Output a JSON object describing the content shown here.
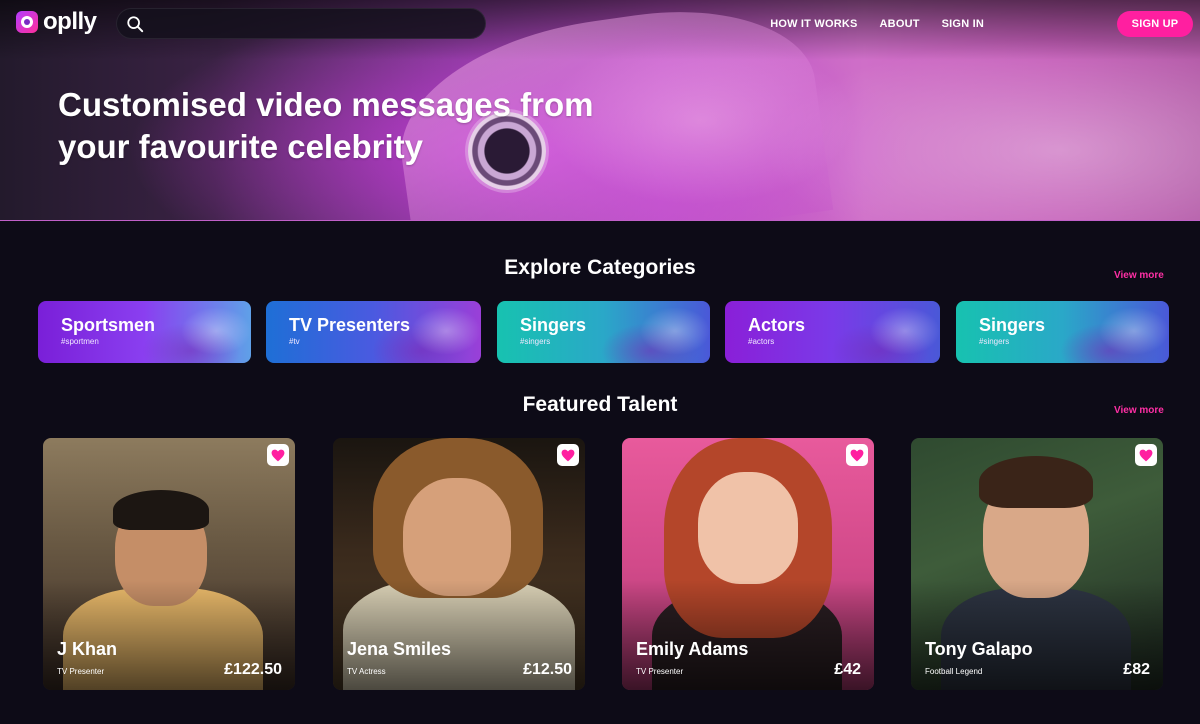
{
  "brand": {
    "name": "oplly",
    "accent": "#ff1fa0",
    "purple": "#7a2cc4"
  },
  "search": {
    "placeholder": "",
    "value": "",
    "icon": "search-icon"
  },
  "nav": {
    "links": [
      "HOW IT WORKS",
      "ABOUT",
      "SIGN IN"
    ],
    "signup_label": "SIGN UP"
  },
  "hero": {
    "title": "Customised video messages from your favourite celebrity"
  },
  "categories": {
    "title": "Explore Categories",
    "view_more": "View more",
    "items": [
      {
        "name": "Sportsmen",
        "tag": "#sportmen",
        "gradient": [
          "#7a1fd8",
          "#8a3ff0",
          "#5fa0e8"
        ]
      },
      {
        "name": "TV Presenters",
        "tag": "#tv",
        "gradient": [
          "#1e6fd6",
          "#4a5ae0",
          "#9a3fd8"
        ]
      },
      {
        "name": "Singers",
        "tag": "#singers",
        "gradient": [
          "#17c2b0",
          "#2aa8c8",
          "#4a58d8"
        ]
      },
      {
        "name": "Actors",
        "tag": "#actors",
        "gradient": [
          "#8a1fd8",
          "#7a3ae8",
          "#4a58d8"
        ]
      },
      {
        "name": "Singers",
        "tag": "#singers",
        "gradient": [
          "#17c2b0",
          "#2aa8c8",
          "#4a58d8"
        ]
      }
    ]
  },
  "featured": {
    "title": "Featured Talent",
    "view_more": "View more",
    "items": [
      {
        "name": "J Khan",
        "role": "TV Presenter",
        "price": "£122.50"
      },
      {
        "name": "Jena Smiles",
        "role": "TV Actress",
        "price": "£12.50"
      },
      {
        "name": "Emily Adams",
        "role": "TV Presenter",
        "price": "£42"
      },
      {
        "name": "Tony Galapo",
        "role": "Football Legend",
        "price": "£82"
      }
    ]
  }
}
